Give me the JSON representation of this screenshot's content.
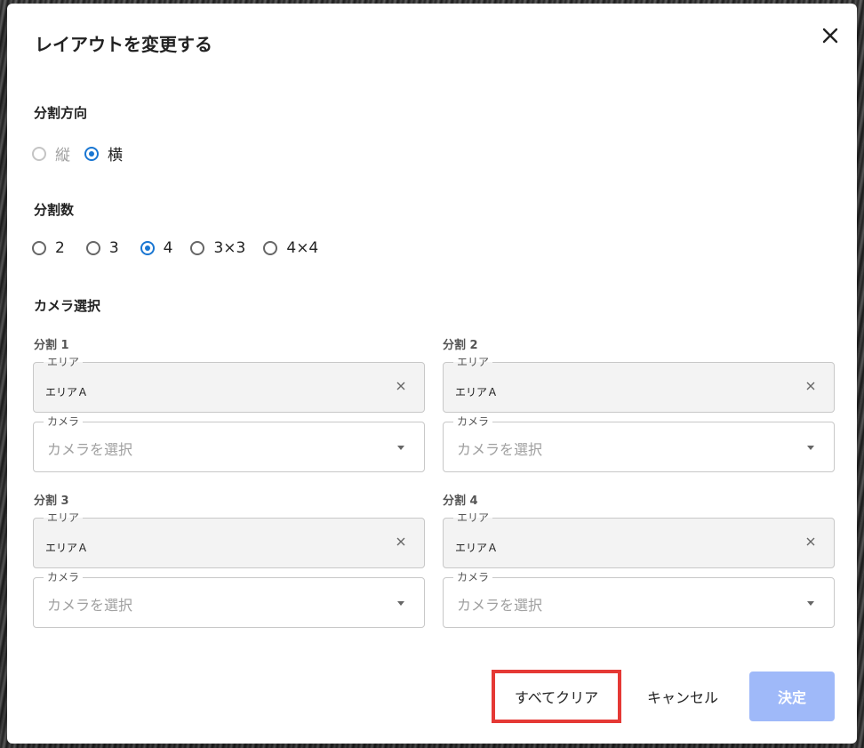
{
  "dialog": {
    "title": "レイアウトを変更する"
  },
  "direction": {
    "label": "分割方向",
    "options": [
      {
        "label": "縦",
        "checked": false,
        "disabled": true
      },
      {
        "label": "横",
        "checked": true,
        "disabled": false
      }
    ]
  },
  "count": {
    "label": "分割数",
    "options": [
      {
        "label": "2",
        "checked": false
      },
      {
        "label": "3",
        "checked": false
      },
      {
        "label": "4",
        "checked": true
      },
      {
        "label": "3×3",
        "checked": false
      },
      {
        "label": "4×4",
        "checked": false
      }
    ]
  },
  "camera_select": {
    "label": "カメラ選択",
    "splits": [
      {
        "label": "分割 1",
        "area_label": "エリア",
        "area_value": "エリアＡ",
        "camera_label": "カメラ",
        "camera_placeholder": "カメラを選択"
      },
      {
        "label": "分割 2",
        "area_label": "エリア",
        "area_value": "エリアＡ",
        "camera_label": "カメラ",
        "camera_placeholder": "カメラを選択"
      },
      {
        "label": "分割 3",
        "area_label": "エリア",
        "area_value": "エリアＡ",
        "camera_label": "カメラ",
        "camera_placeholder": "カメラを選択"
      },
      {
        "label": "分割 4",
        "area_label": "エリア",
        "area_value": "エリアＡ",
        "camera_label": "カメラ",
        "camera_placeholder": "カメラを選択"
      }
    ]
  },
  "actions": {
    "clear_all": "すべてクリア",
    "cancel": "キャンセル",
    "confirm": "決定"
  },
  "colors": {
    "accent": "#1976d2",
    "confirm_disabled": "#9fb9f9",
    "highlight": "#e53935"
  },
  "icons": {
    "close": "close-icon",
    "clear": "clear-icon",
    "dropdown": "chevron-down-icon"
  }
}
